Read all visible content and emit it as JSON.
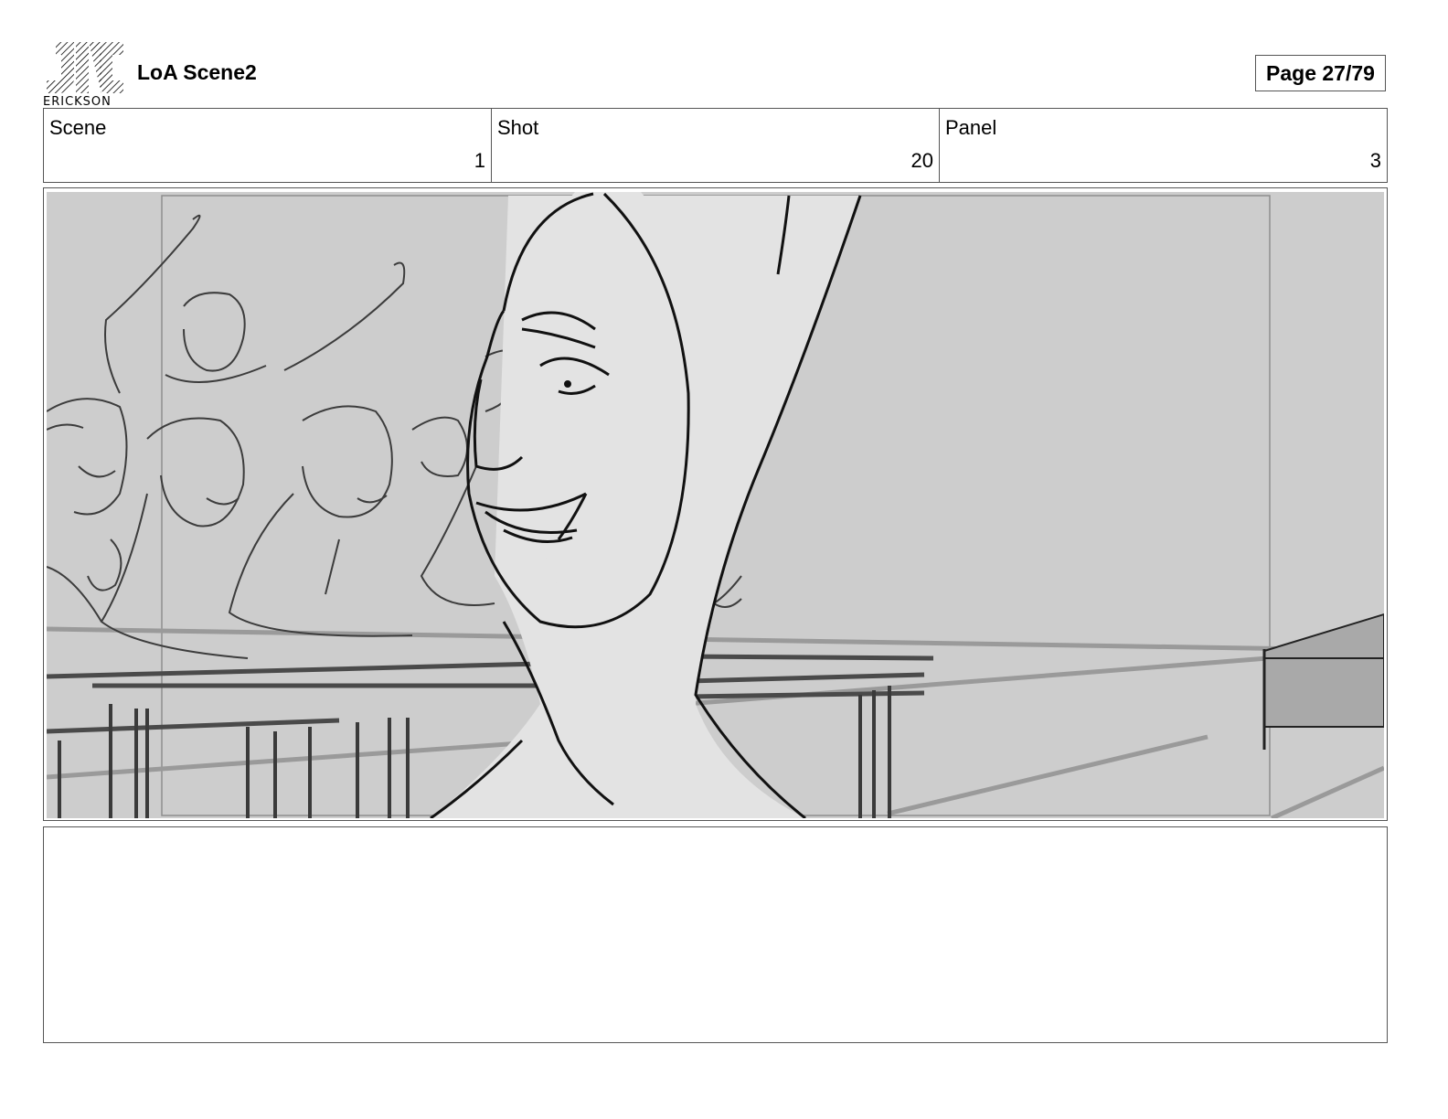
{
  "header": {
    "logo_text": "ERICKSON",
    "title": "LoA Scene2",
    "page": "Page 27/79"
  },
  "info": {
    "scene_label": "Scene",
    "scene_value": "1",
    "shot_label": "Shot",
    "shot_value": "20",
    "panel_label": "Panel",
    "panel_value": "3"
  },
  "notes": {
    "text": ""
  }
}
